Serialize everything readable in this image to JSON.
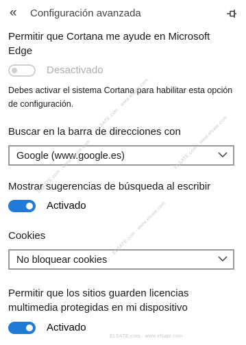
{
  "header": {
    "title": "Configuración avanzada"
  },
  "cortana": {
    "title": "Permitir que Cortana me ayude en Microsoft Edge",
    "toggle_state": "off",
    "toggle_label": "Desactivado",
    "note": "Debes activar el sistema Cortana para habilitar esta opción de configuración."
  },
  "address_bar_search": {
    "title": "Buscar en la barra de direcciones con",
    "selected": "Google (www.google.es)"
  },
  "search_suggestions": {
    "title": "Mostrar sugerencias de búsqueda al escribir",
    "toggle_state": "on",
    "toggle_label": "Activado"
  },
  "cookies": {
    "title": "Cookies",
    "selected": "No bloquear cookies"
  },
  "media_licenses": {
    "title": "Permitir que los sitios guarden licencias multimedia protegidas en mi dispositivo",
    "toggle_state": "on",
    "toggle_label": "Activado"
  },
  "colors": {
    "accent": "#1f7bd6",
    "disabled": "#cfcfcf"
  },
  "icons": {
    "back": "back-chevrons-icon",
    "pin": "pin-icon",
    "dropdown": "chevron-down-icon"
  }
}
